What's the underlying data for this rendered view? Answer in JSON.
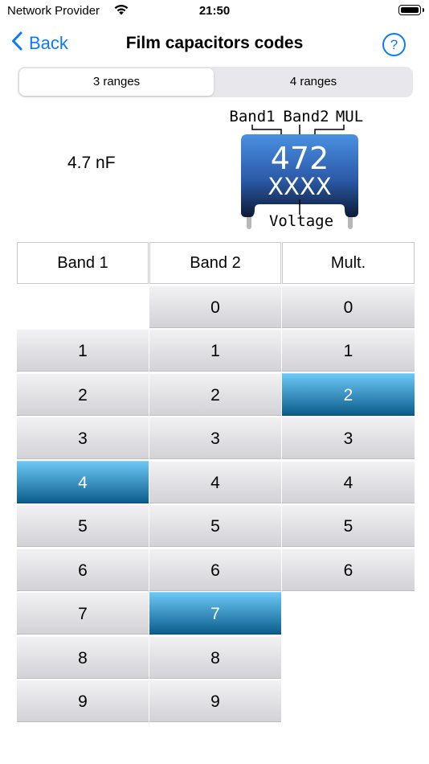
{
  "status_bar": {
    "carrier": "Network Provider",
    "time": "21:50"
  },
  "nav": {
    "back_label": "Back",
    "title": "Film capacitors codes",
    "help_label": "?"
  },
  "segments": [
    {
      "label": "3 ranges",
      "selected": true
    },
    {
      "label": "4 ranges",
      "selected": false
    }
  ],
  "result": {
    "value": "4.7 nF"
  },
  "diagram": {
    "labels": [
      "Band1",
      "Band2",
      "MUL"
    ],
    "code": "472",
    "subcode": "XXXX",
    "voltage_label": "Voltage",
    "body_color": "#3d7fd8"
  },
  "table": {
    "headers": [
      "Band 1",
      "Band 2",
      "Mult."
    ],
    "columns": [
      {
        "values": [
          "1",
          "2",
          "3",
          "4",
          "5",
          "6",
          "7",
          "8",
          "9"
        ],
        "selected": "4"
      },
      {
        "values": [
          "0",
          "1",
          "2",
          "3",
          "4",
          "5",
          "6",
          "7",
          "8",
          "9"
        ],
        "selected": "7"
      },
      {
        "values": [
          "0",
          "1",
          "2",
          "3",
          "4",
          "5",
          "6"
        ],
        "selected": "2"
      }
    ]
  },
  "colors": {
    "accent": "#0a7aff",
    "selected_top": "#6cc7f5",
    "selected_bottom": "#0b5e8c"
  }
}
